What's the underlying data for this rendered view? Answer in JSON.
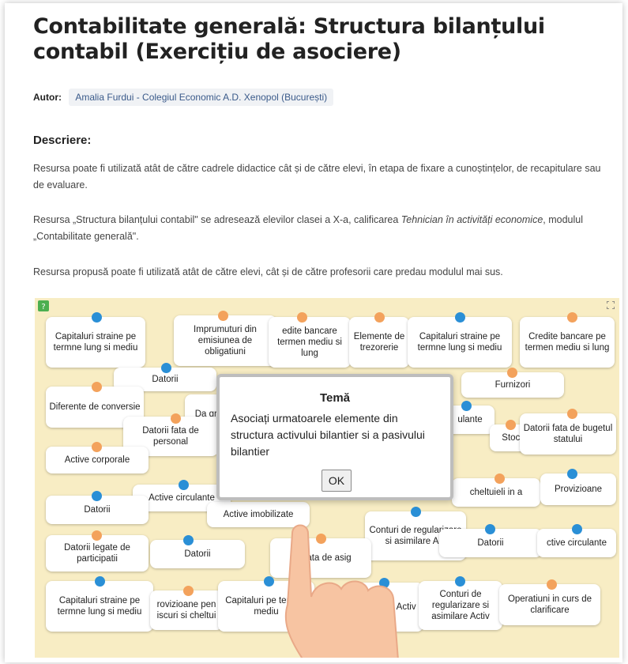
{
  "header": {
    "title": "Contabilitate generală: Structura bilanțului contabil (Exercițiu de asociere)",
    "author_label": "Autor:",
    "author_value": "Amalia Furdui - Colegiul Economic A.D. Xenopol (București)"
  },
  "description": {
    "heading": "Descriere:",
    "p1": "Resursa poate fi utilizată atât de către cadrele didactice cât și de către elevi, în etapa de fixare a cunoștințelor, de recapitulare sau de evaluare.",
    "p2_a": "Resursa „Structura bilanțului contabil\" se adresează elevilor clasei a X-a, calificarea ",
    "p2_italic": "Tehnician în activități economice",
    "p2_b": ", modulul „Contabilitate generală\".",
    "p3": "Resursa propusă poate fi utilizată atât de către elevi, cât și de către profesorii care predau modulul mai sus."
  },
  "game": {
    "cards": [
      {
        "label": "Capitaluri straine pe termne lung si mediu",
        "dot": "blue"
      },
      {
        "label": "Imprumuturi din emisiunea de obligatiuni",
        "dot": "orange"
      },
      {
        "label": "edite bancare termen mediu si lung",
        "dot": "orange"
      },
      {
        "label": "Elemente de trezorerie",
        "dot": "orange"
      },
      {
        "label": "Capitaluri straine pe termne lung si mediu",
        "dot": "blue"
      },
      {
        "label": "Credite bancare pe termen mediu si lung",
        "dot": "orange"
      },
      {
        "label": "Datorii",
        "dot": "blue"
      },
      {
        "label": "Furnizori",
        "dot": "orange"
      },
      {
        "label": "Diferente de conversie",
        "dot": "orange"
      },
      {
        "label": "Da gru",
        "dot": "orange"
      },
      {
        "label": "Datorii fata de personal",
        "dot": "orange"
      },
      {
        "label": "ulante",
        "dot": "blue"
      },
      {
        "label": "Stocu",
        "dot": "orange"
      },
      {
        "label": "Datorii fata de bugetul statului",
        "dot": "orange"
      },
      {
        "label": "Active corporale",
        "dot": "orange"
      },
      {
        "label": "Active circulante",
        "dot": "blue"
      },
      {
        "label": "cheltuieli in a",
        "dot": "orange"
      },
      {
        "label": "Provizioane",
        "dot": "blue"
      },
      {
        "label": "Datorii",
        "dot": "blue"
      },
      {
        "label": "Active imobilizate",
        "dot": "blue"
      },
      {
        "label": "Conturi de regularizare si asimilare Act",
        "dot": "blue"
      },
      {
        "label": "Datorii",
        "dot": "blue"
      },
      {
        "label": "ctive circulante",
        "dot": "blue"
      },
      {
        "label": "Datorii legate de participatii",
        "dot": "orange"
      },
      {
        "label": "Datorii",
        "dot": "blue"
      },
      {
        "label": "Da fata de asig",
        "dot": "orange"
      },
      {
        "label": "Capitaluri straine pe termne lung si mediu",
        "dot": "blue"
      },
      {
        "label": "rovizioane pen iscuri si cheltui",
        "dot": "orange"
      },
      {
        "label": "Capitaluri pe termne mediu",
        "dot": "blue"
      },
      {
        "label": "ri de are si Activ",
        "dot": "blue"
      },
      {
        "label": "Conturi de regularizare si asimilare Activ",
        "dot": "blue"
      },
      {
        "label": "Operatiuni in curs de clarificare",
        "dot": "orange"
      }
    ],
    "modal": {
      "title": "Temă",
      "text": "Asociați urmatoarele elemente din structura activului bilantier si a pasivului bilantier",
      "ok_label": "OK"
    },
    "colors": {
      "background": "#f8edc4",
      "dot_blue": "#2a8fd6",
      "dot_orange": "#f3a25c"
    }
  }
}
